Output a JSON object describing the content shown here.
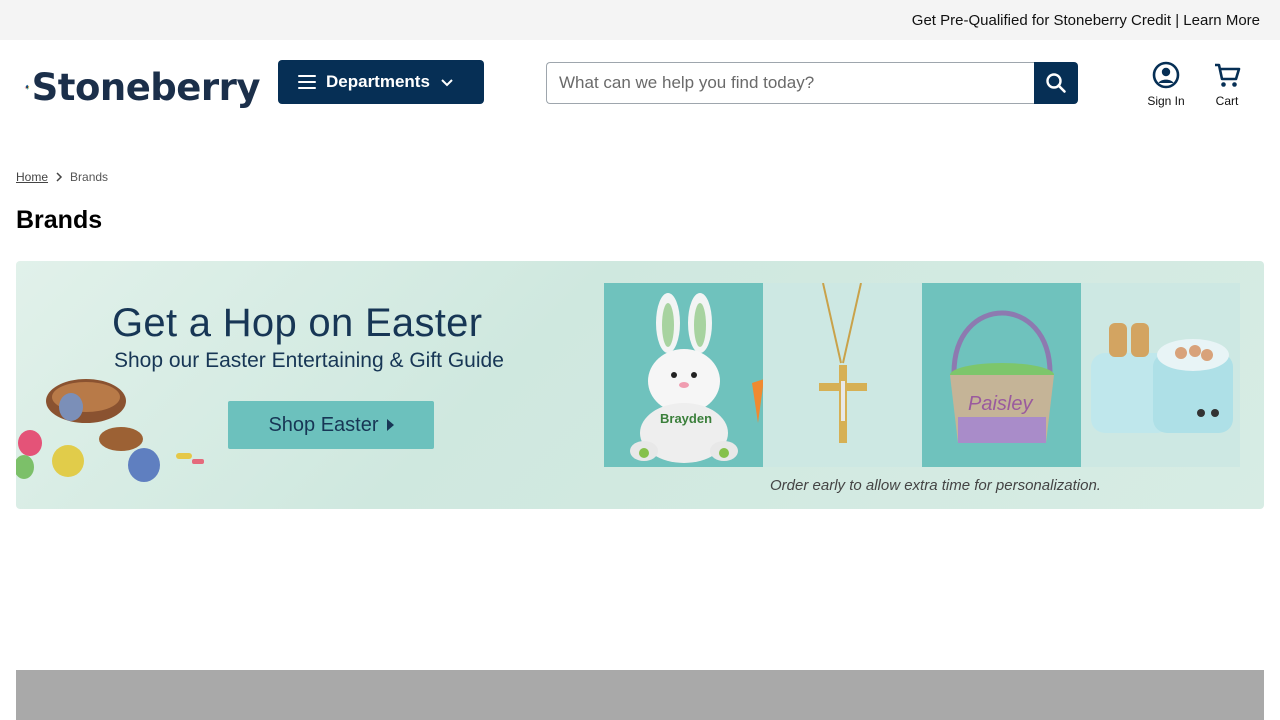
{
  "promo": {
    "text": "Get Pre-Qualified for Stoneberry Credit | Learn More"
  },
  "header": {
    "logo_text": "Stoneberry",
    "departments_label": "Departments",
    "search_placeholder": "What can we help you find today?",
    "sign_in_label": "Sign In",
    "cart_label": "Cart"
  },
  "breadcrumb": {
    "home": "Home",
    "current": "Brands"
  },
  "page": {
    "title": "Brands"
  },
  "banner": {
    "headline": "Get a Hop on Easter",
    "subheadline": "Shop our Easter Entertaining & Gift Guide",
    "cta": "Shop Easter",
    "note": "Order early to allow extra time for personalization.",
    "plush_name": "Brayden",
    "basket_name": "Paisley"
  },
  "colors": {
    "navy": "#062f55",
    "teal": "#6fc2bd",
    "promo_bg": "#f4f4f4"
  }
}
